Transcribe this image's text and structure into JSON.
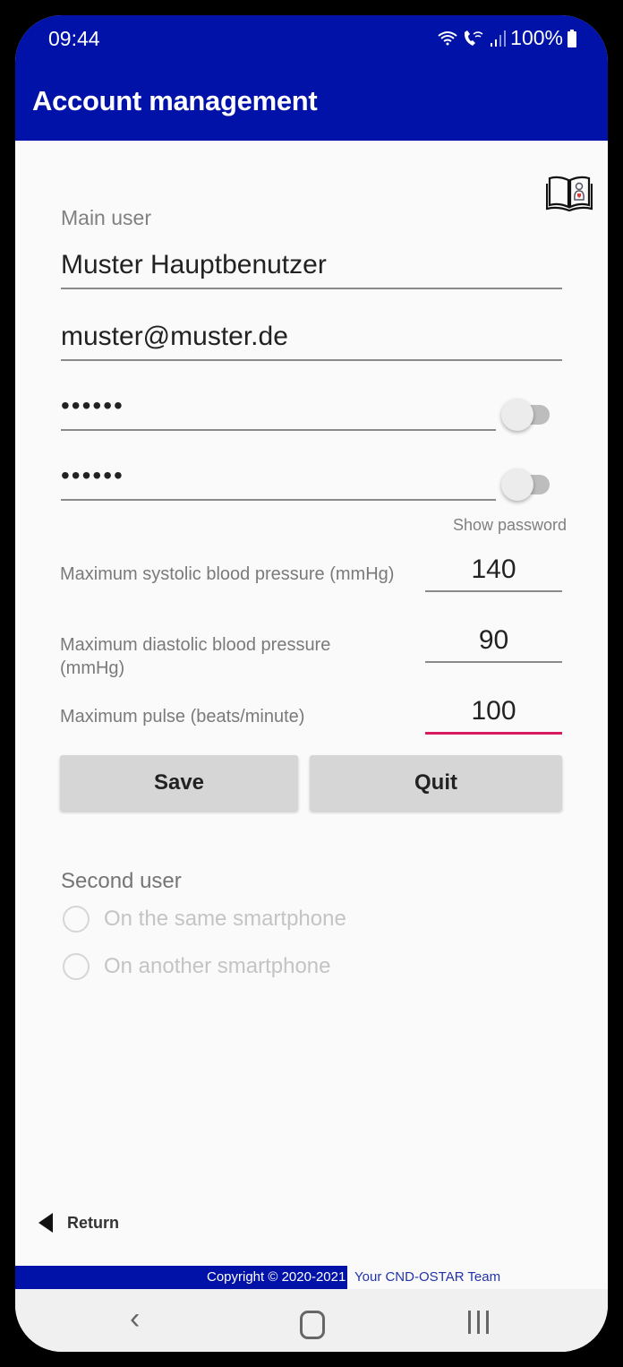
{
  "status_bar": {
    "time": "09:44",
    "battery": "100%",
    "icons": [
      "wifi-icon",
      "wifi-call-icon",
      "signal-icon",
      "battery-icon"
    ]
  },
  "app_bar": {
    "title": "Account management"
  },
  "help": {
    "icon": "manual-book-icon"
  },
  "main_user": {
    "label": "Main user",
    "name_value": "Muster Hauptbenutzer",
    "email_value": "muster@muster.de",
    "password_value": "••••••",
    "password_confirm_value": "••••••",
    "show_password_label": "Show password"
  },
  "limits": [
    {
      "label": "Maximum systolic blood pressure (mmHg)",
      "value": "140"
    },
    {
      "label": "Maximum diastolic blood pressure (mmHg)",
      "value": "90"
    },
    {
      "label": "Maximum pulse (beats/minute)",
      "value": "100"
    }
  ],
  "buttons": {
    "save": "Save",
    "quit": "Quit"
  },
  "second_user": {
    "label": "Second user",
    "options": [
      "On the same smartphone",
      "On another smartphone"
    ]
  },
  "return_label": "Return",
  "footer": {
    "copyright": "Copyright © 2020-2021",
    "team": "Your CND-OSTAR Team"
  },
  "colors": {
    "primary": "#0012a8",
    "focus_accent": "#d81b60"
  }
}
